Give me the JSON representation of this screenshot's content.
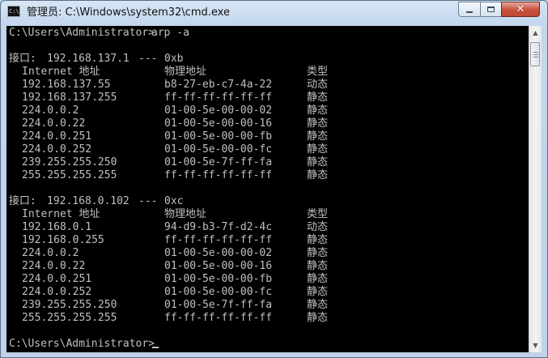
{
  "window": {
    "title": "管理员: C:\\Windows\\system32\\cmd.exe",
    "icon_text": "C:\\",
    "buttons": {
      "minimize": "minimize",
      "maximize": "maximize",
      "close": "✕"
    }
  },
  "console": {
    "prompt": "C:\\Users\\Administrator>",
    "command": "arp -a",
    "interfaces": [
      {
        "header_label": "接口:",
        "ip": "192.168.137.1",
        "separator": "---",
        "index": "0xb",
        "columns": {
          "address": "Internet 地址",
          "mac": "物理地址",
          "type": "类型"
        },
        "entries": [
          {
            "address": "192.168.137.55",
            "mac": "b8-27-eb-c7-4a-22",
            "type": "动态"
          },
          {
            "address": "192.168.137.255",
            "mac": "ff-ff-ff-ff-ff-ff",
            "type": "静态"
          },
          {
            "address": "224.0.0.2",
            "mac": "01-00-5e-00-00-02",
            "type": "静态"
          },
          {
            "address": "224.0.0.22",
            "mac": "01-00-5e-00-00-16",
            "type": "静态"
          },
          {
            "address": "224.0.0.251",
            "mac": "01-00-5e-00-00-fb",
            "type": "静态"
          },
          {
            "address": "224.0.0.252",
            "mac": "01-00-5e-00-00-fc",
            "type": "静态"
          },
          {
            "address": "239.255.255.250",
            "mac": "01-00-5e-7f-ff-fa",
            "type": "静态"
          },
          {
            "address": "255.255.255.255",
            "mac": "ff-ff-ff-ff-ff-ff",
            "type": "静态"
          }
        ]
      },
      {
        "header_label": "接口:",
        "ip": "192.168.0.102",
        "separator": "---",
        "index": "0xc",
        "columns": {
          "address": "Internet 地址",
          "mac": "物理地址",
          "type": "类型"
        },
        "entries": [
          {
            "address": "192.168.0.1",
            "mac": "94-d9-b3-7f-d2-4c",
            "type": "动态"
          },
          {
            "address": "192.168.0.255",
            "mac": "ff-ff-ff-ff-ff-ff",
            "type": "静态"
          },
          {
            "address": "224.0.0.2",
            "mac": "01-00-5e-00-00-02",
            "type": "静态"
          },
          {
            "address": "224.0.0.22",
            "mac": "01-00-5e-00-00-16",
            "type": "静态"
          },
          {
            "address": "224.0.0.251",
            "mac": "01-00-5e-00-00-fb",
            "type": "静态"
          },
          {
            "address": "224.0.0.252",
            "mac": "01-00-5e-00-00-fc",
            "type": "静态"
          },
          {
            "address": "239.255.255.250",
            "mac": "01-00-5e-7f-ff-fa",
            "type": "静态"
          },
          {
            "address": "255.255.255.255",
            "mac": "ff-ff-ff-ff-ff-ff",
            "type": "静态"
          }
        ]
      }
    ]
  },
  "scrollbar": {
    "up_arrow": "▲",
    "down_arrow": "▼"
  }
}
